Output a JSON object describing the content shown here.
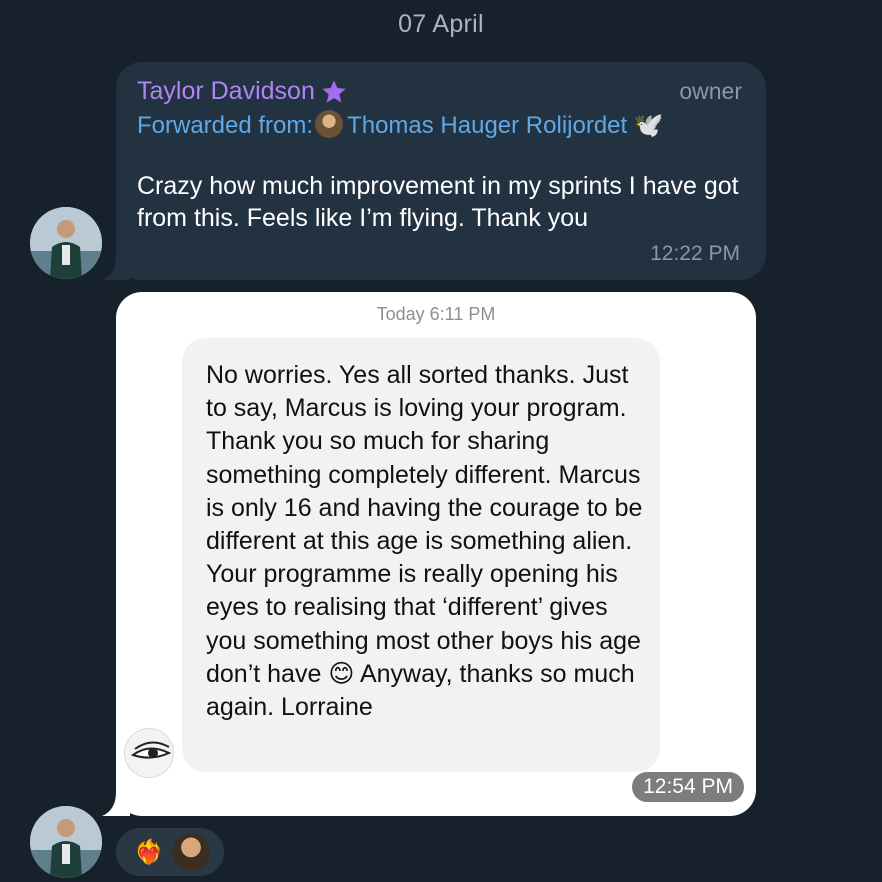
{
  "date_separator": "07 April",
  "forwarded_message": {
    "sender_name": "Taylor Davidson",
    "sender_badge_icon": "star-icon",
    "role": "owner",
    "forward_prefix": "Forwarded from:",
    "forward_source": "Thomas Hauger Rolijordet",
    "forward_source_emoji": "🕊️",
    "text": "Crazy how much improvement in my sprints I have got from this. Feels like I’m flying. Thank you",
    "time": "12:22 PM",
    "name_color": "#b084f5",
    "link_color": "#5fa8e8"
  },
  "screenshot_message": {
    "header_time": "Today 6:11 PM",
    "body": "No worries. Yes all sorted thanks. Just to say, Marcus is loving your program. Thank you so much for sharing something completely different. Marcus is only 16 and having the courage to be different at this age is something alien. Your programme is really opening his eyes to realising that ‘different’ gives you something most other boys his age don’t have 😊 Anyway, thanks so much again. Lorraine",
    "time": "12:54 PM"
  },
  "reactions": {
    "emoji": "❤️‍🔥"
  },
  "colors": {
    "background": "#17212b",
    "dark_bubble": "#233241",
    "light_bubble": "#ffffff"
  }
}
